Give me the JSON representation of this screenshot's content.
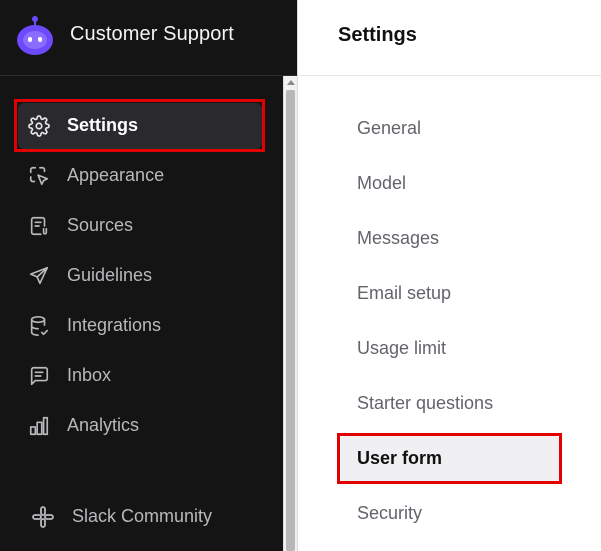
{
  "app": {
    "name": "Customer Support",
    "brand_color": "#6d4aff",
    "highlight_color": "#e30000"
  },
  "sidebar": {
    "items": [
      {
        "label": "Settings",
        "icon": "gear-icon",
        "active": true
      },
      {
        "label": "Appearance",
        "icon": "cursor-icon",
        "active": false
      },
      {
        "label": "Sources",
        "icon": "document-icon",
        "active": false
      },
      {
        "label": "Guidelines",
        "icon": "send-icon",
        "active": false
      },
      {
        "label": "Integrations",
        "icon": "database-icon",
        "active": false
      },
      {
        "label": "Inbox",
        "icon": "message-icon",
        "active": false
      },
      {
        "label": "Analytics",
        "icon": "bar-chart-icon",
        "active": false
      }
    ],
    "footer": {
      "label": "Slack Community",
      "icon": "slack-icon"
    }
  },
  "header": {
    "title": "Settings"
  },
  "settings_nav": {
    "items": [
      {
        "label": "General",
        "active": false
      },
      {
        "label": "Model",
        "active": false
      },
      {
        "label": "Messages",
        "active": false
      },
      {
        "label": "Email setup",
        "active": false
      },
      {
        "label": "Usage limit",
        "active": false
      },
      {
        "label": "Starter questions",
        "active": false
      },
      {
        "label": "User form",
        "active": true
      },
      {
        "label": "Security",
        "active": false
      }
    ]
  }
}
